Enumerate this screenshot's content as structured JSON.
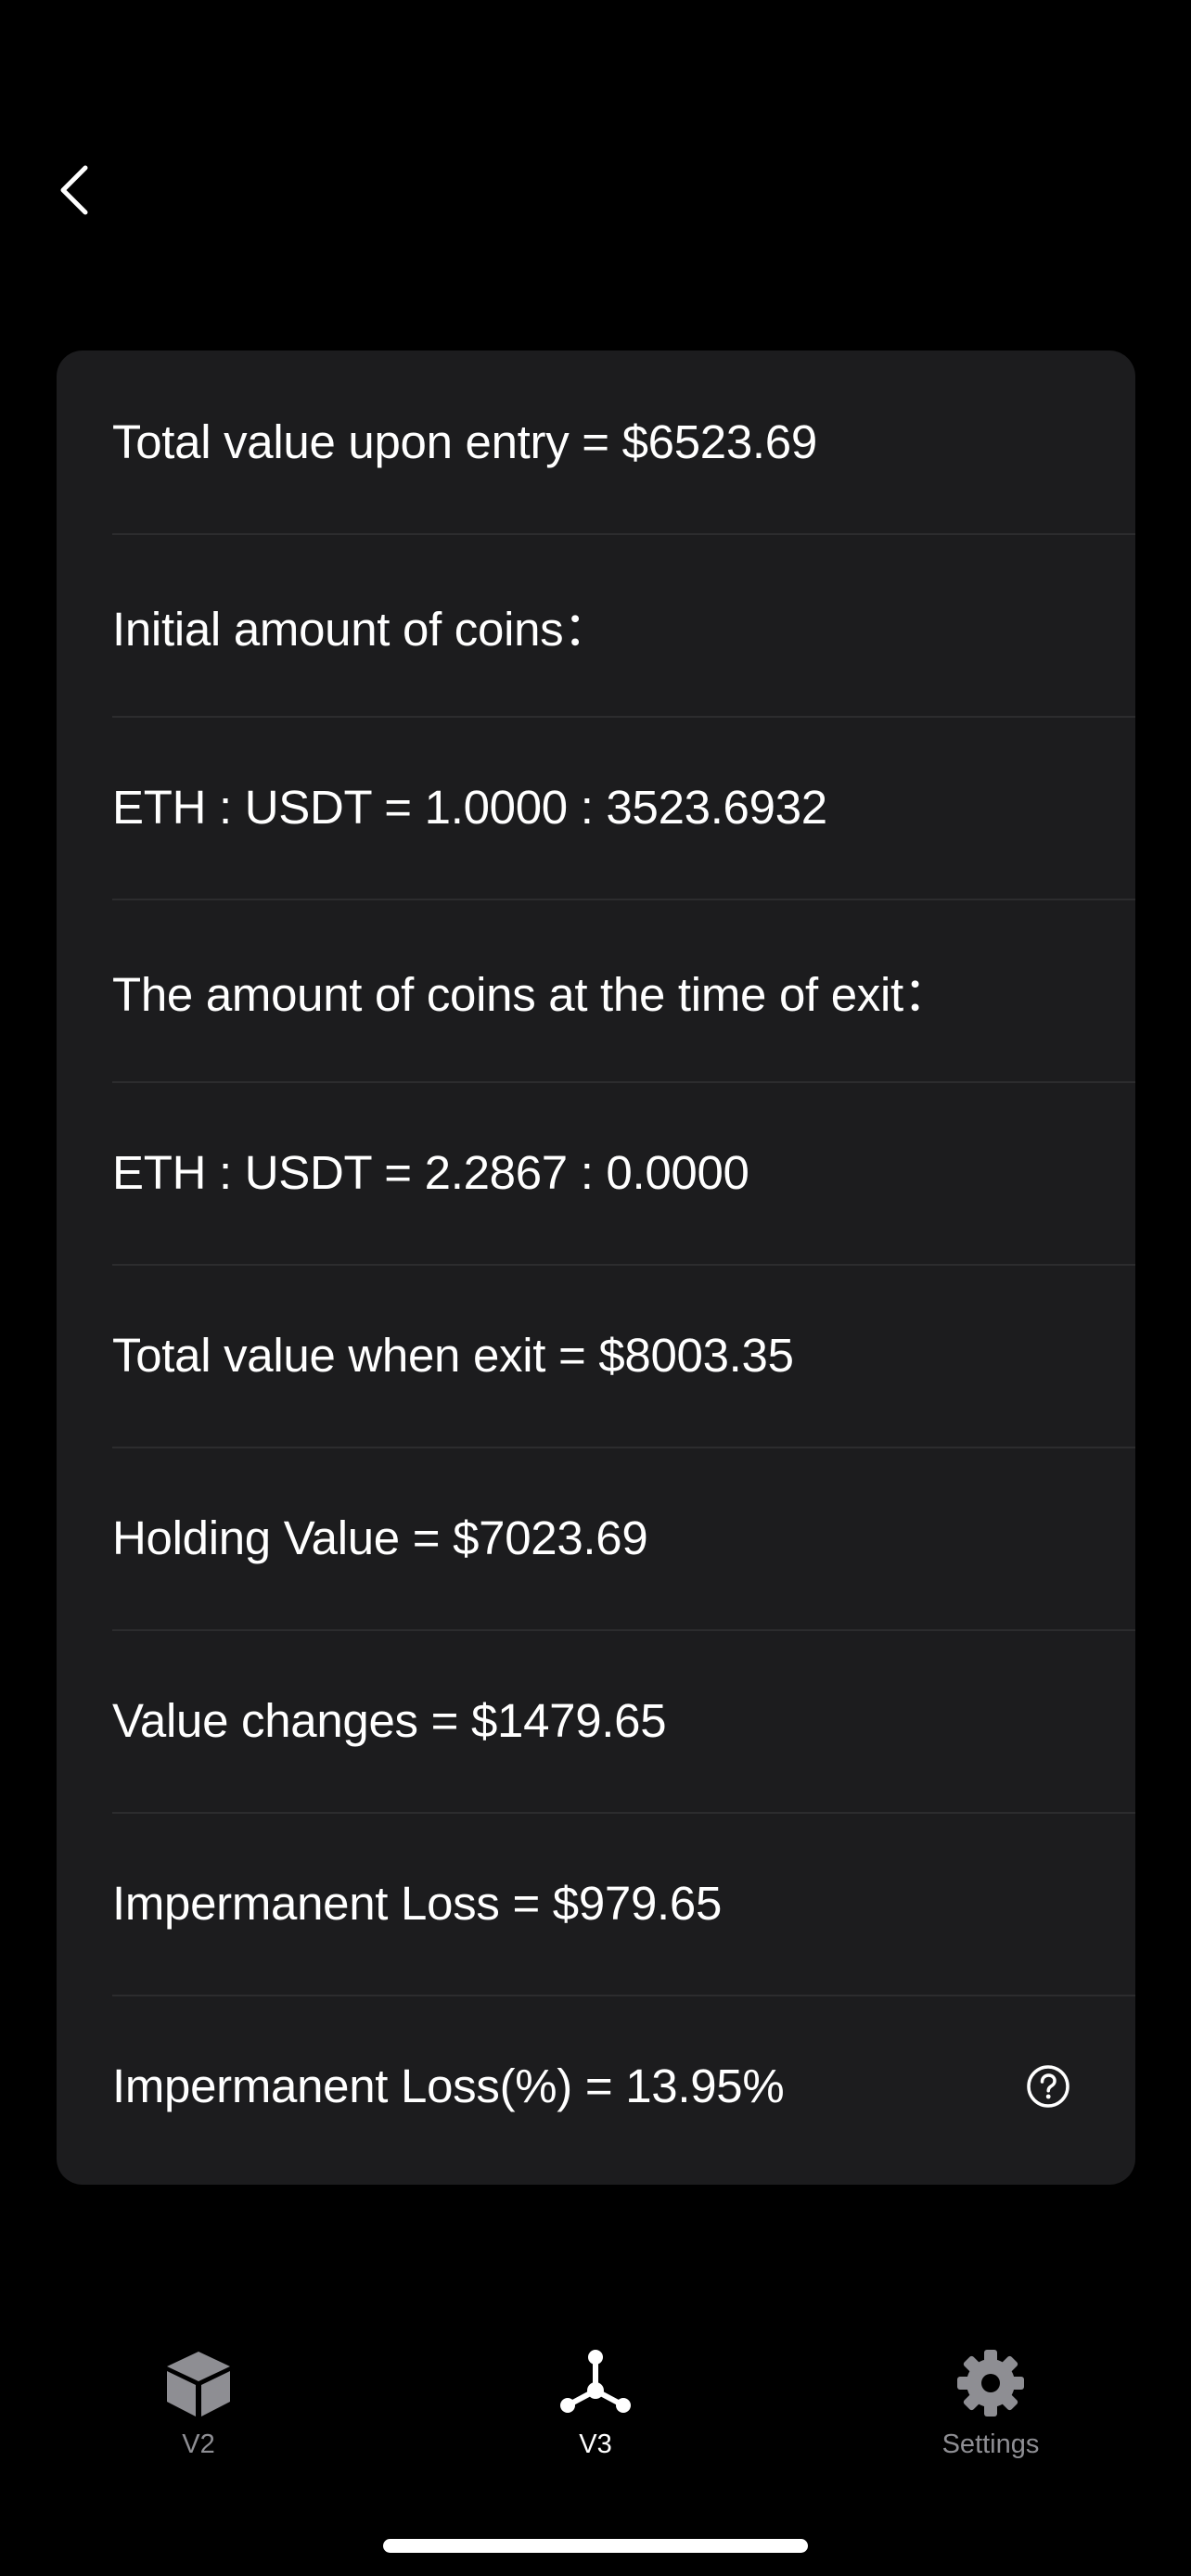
{
  "nav": {
    "back_icon": "chevron-left-icon"
  },
  "results": {
    "rows": [
      {
        "text": "Total value upon entry = $6523.69"
      },
      {
        "text": "Initial amount of coins："
      },
      {
        "text": "ETH : USDT = 1.0000 : 3523.6932"
      },
      {
        "text": "The amount of coins at the time of exit："
      },
      {
        "text": "ETH : USDT = 2.2867 : 0.0000"
      },
      {
        "text": "Total value when exit = $8003.35"
      },
      {
        "text": "Holding Value = $7023.69"
      },
      {
        "text": "Value changes = $1479.65"
      },
      {
        "text": "Impermanent Loss = $979.65"
      },
      {
        "text": "Impermanent Loss(%) = 13.95%",
        "icon": "question-circle-icon"
      }
    ]
  },
  "tabbar": {
    "tabs": [
      {
        "label": "V2",
        "icon": "cube-icon",
        "active": false
      },
      {
        "label": "V3",
        "icon": "network-nodes-icon",
        "active": true
      },
      {
        "label": "Settings",
        "icon": "gear-icon",
        "active": false
      }
    ]
  },
  "colors": {
    "background": "#000000",
    "card": "#1c1c1e",
    "divider": "#2c2c2e",
    "text": "#ffffff",
    "inactive_tab": "#8e8e93"
  }
}
